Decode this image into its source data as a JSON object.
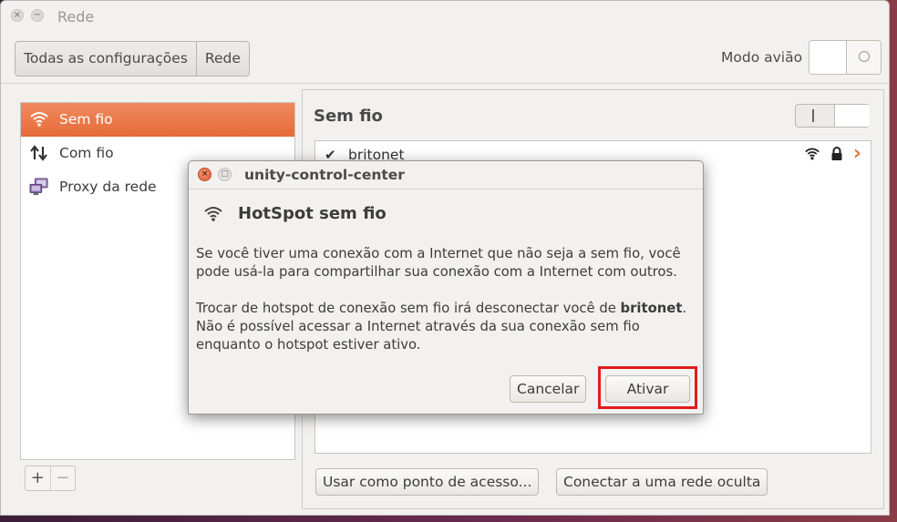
{
  "window": {
    "title": "Rede",
    "close_glyph": "×",
    "min_glyph": "−"
  },
  "toolbar": {
    "breadcrumb": [
      "Todas as configurações",
      "Rede"
    ],
    "airplane_label": "Modo avião"
  },
  "sidebar": {
    "items": [
      {
        "label": "Sem fio",
        "icon": "wifi-icon",
        "selected": true
      },
      {
        "label": "Com fio",
        "icon": "wired-arrows-icon",
        "selected": false
      },
      {
        "label": "Proxy da rede",
        "icon": "proxy-icon",
        "selected": false
      }
    ],
    "add": "+",
    "remove": "−"
  },
  "main": {
    "title": "Sem fio",
    "networks": [
      {
        "name": "britonet",
        "connected": true,
        "check": "✔",
        "arrow": "›",
        "icons": [
          "wifi-signal-icon",
          "lock-icon",
          "chevron-right-icon"
        ]
      }
    ],
    "hotspot_button": "Usar como ponto de acesso...",
    "hidden_button": "Conectar a uma rede oculta"
  },
  "dialog": {
    "title": "unity-control-center",
    "close_glyph": "×",
    "max_glyph": "□",
    "heading": "HotSpot sem fio",
    "para1": "Se você tiver uma conexão com a Internet que não seja a sem fio, você pode usá-la para compartilhar sua conexão com a Internet com outros.",
    "para2_pre": "Trocar de hotspot de conexão sem fio irá desconectar você de ",
    "para2_bold": "britonet",
    "para2_post": ". Não é possível acessar a Internet através da sua conexão sem fio enquanto o hotspot estiver ativo.",
    "cancel": "Cancelar",
    "activate": "Ativar"
  },
  "colors": {
    "accent": "#e9703f",
    "highlight": "#e11b1b"
  }
}
